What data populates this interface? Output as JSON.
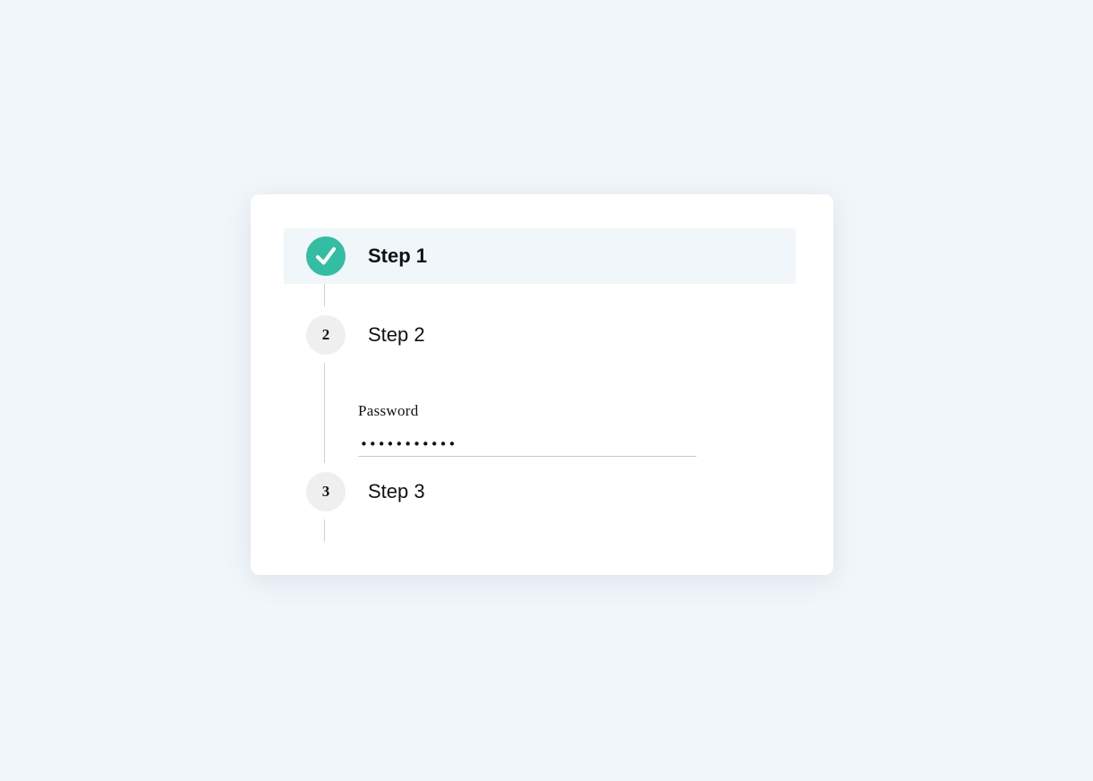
{
  "stepper": {
    "steps": [
      {
        "label": "Step 1",
        "status": "completed",
        "icon": "check-icon"
      },
      {
        "label": "Step 2",
        "number": "2",
        "status": "current"
      },
      {
        "label": "Step 3",
        "number": "3",
        "status": "pending"
      }
    ],
    "active_step_content": {
      "password_label": "Password",
      "password_value": "•••••••••••"
    }
  },
  "colors": {
    "page_background": "#f1f6fa",
    "completed_step": "#35bda4",
    "active_row_highlight": "#f0f6f9",
    "pending_circle": "#efefef",
    "connector_line": "#d0d0d0"
  }
}
